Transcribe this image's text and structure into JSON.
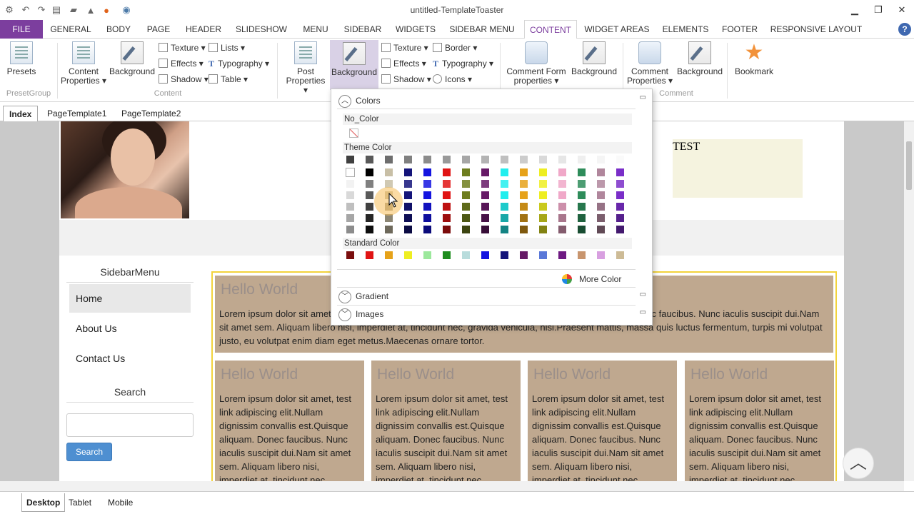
{
  "window": {
    "title": "untitled-TemplateToaster"
  },
  "menu": {
    "file": "FILE",
    "tabs": [
      "GENERAL",
      "BODY",
      "PAGE",
      "HEADER",
      "SLIDESHOW",
      "MENU",
      "SIDEBAR",
      "WIDGETS",
      "SIDEBAR MENU",
      "CONTENT",
      "WIDGET AREAS",
      "ELEMENTS",
      "FOOTER",
      "RESPONSIVE LAYOUT"
    ],
    "active": "CONTENT",
    "help": "?"
  },
  "ribbon": {
    "presets": "Presets",
    "preset_group": "PresetGroup",
    "content_properties": "Content Properties ▾",
    "background1": "Background",
    "texture1": "Texture ▾",
    "effects1": "Effects ▾",
    "shadow1": "Shadow ▾",
    "lists": "Lists ▾",
    "typography1": "Typography ▾",
    "table": "Table ▾",
    "content_group": "Content",
    "post_properties": "Post Properties ▾",
    "background2": "Background",
    "texture2": "Texture ▾",
    "effects2": "Effects ▾",
    "shadow2": "Shadow ▾",
    "border": "Border ▾",
    "typography2": "Typography ▾",
    "icons": "Icons ▾",
    "comment_form": "Comment Form properties ▾",
    "background3": "Background",
    "comment_properties": "Comment Properties ▾",
    "background4": "Background",
    "bookmark": "Bookmark",
    "comment_group": "Comment"
  },
  "pagetabs": [
    "Index",
    "PageTemplate1",
    "PageTemplate2"
  ],
  "canvas": {
    "test": "TEST",
    "sidebar_title": "SidebarMenu",
    "sidebar_items": [
      "Home",
      "About Us",
      "Contact Us"
    ],
    "search_title": "Search",
    "search_button": "Search",
    "main_heading": "Hello World",
    "main_text": "Lorem ipsum dolor sit amet, test link adipiscing elit.Nullam dignissim convallis est.Quisque aliquam. Donec faucibus. Nunc iaculis suscipit dui.Nam sit amet sem. Aliquam libero nisi, imperdiet at, tincidunt nec, gravida vehicula, nisl.Praesent mattis, massa quis luctus fermentum, turpis mi volutpat justo, eu volutpat enim diam eget metus.Maecenas ornare tortor.",
    "col_heading": "Hello World",
    "col_text": "Lorem ipsum dolor sit amet, test link adipiscing elit.Nullam dignissim convallis est.Quisque aliquam. Donec faucibus. Nunc iaculis suscipit dui.Nam sit amet sem. Aliquam libero nisi, imperdiet at, tincidunt nec,"
  },
  "devices": [
    "Desktop",
    "Tablet",
    "Mobile"
  ],
  "colors_panel": {
    "colors": "Colors",
    "no_color": "No_Color",
    "theme_color": "Theme Color",
    "standard_color": "Standard Color",
    "more_color": "More Color",
    "gradient": "Gradient",
    "images": "Images",
    "theme_base": [
      "#ffffff",
      "#000000",
      "#c8bfa6",
      "#14147a",
      "#1414e0",
      "#e01414",
      "#6e7d1e",
      "#661a66",
      "#22eeee",
      "#e6a21a",
      "#eeee22",
      "#f0a8c8",
      "#2e8c5a",
      "#b0869c",
      "#7a2ec8"
    ],
    "grays": [
      "#404040",
      "#595959",
      "#6e6e6e",
      "#808080",
      "#8c8c8c",
      "#999999",
      "#a6a6a6",
      "#b3b3b3",
      "#bfbfbf",
      "#cccccc",
      "#d9d9d9",
      "#e6e6e6",
      "#efefef",
      "#f5f5f5",
      "#fafafa"
    ],
    "standard": [
      "#7a0e0e",
      "#e01414",
      "#e6a21a",
      "#eeee22",
      "#9ce89c",
      "#1e8c1e",
      "#b8dcdc",
      "#1414e0",
      "#14147a",
      "#661a66",
      "#5a78d8",
      "#6e1a82",
      "#c8956e",
      "#d8a0e0",
      "#cdbb96"
    ]
  }
}
